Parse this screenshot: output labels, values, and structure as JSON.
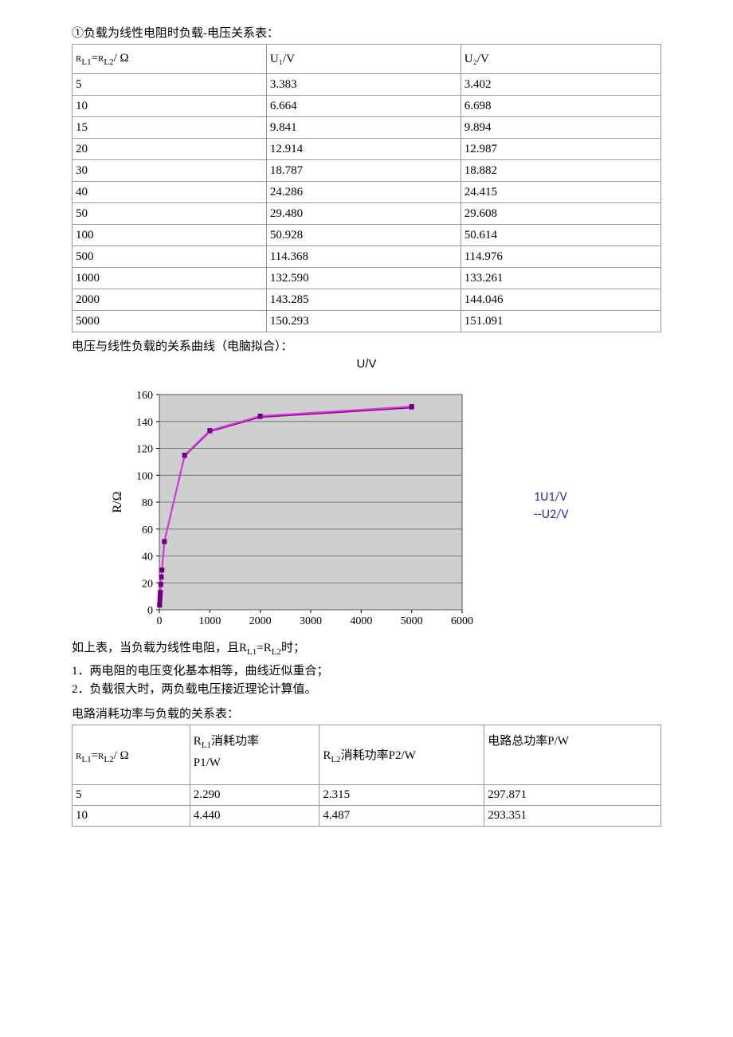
{
  "heading1": "①负载为线性电阻时负载-电压关系表：",
  "table1": {
    "headers": {
      "c0": "RL1=RL2/ Ω",
      "c1": "U₁/V",
      "c2": "U₂/V"
    },
    "rows": [
      {
        "c0": "5",
        "c1": "3.383",
        "c2": "3.402"
      },
      {
        "c0": "10",
        "c1": "6.664",
        "c2": "6.698"
      },
      {
        "c0": "15",
        "c1": "9.841",
        "c2": "9.894"
      },
      {
        "c0": "20",
        "c1": "12.914",
        "c2": "12.987"
      },
      {
        "c0": "30",
        "c1": "18.787",
        "c2": "18.882"
      },
      {
        "c0": "40",
        "c1": "24.286",
        "c2": "24.415"
      },
      {
        "c0": "50",
        "c1": "29.480",
        "c2": "29.608"
      },
      {
        "c0": "100",
        "c1": "50.928",
        "c2": "50.614"
      },
      {
        "c0": "500",
        "c1": "114.368",
        "c2": "114.976"
      },
      {
        "c0": "1000",
        "c1": "132.590",
        "c2": "133.261"
      },
      {
        "c0": "2000",
        "c1": "143.285",
        "c2": "144.046"
      },
      {
        "c0": "5000",
        "c1": "150.293",
        "c2": "151.091"
      }
    ]
  },
  "caption1": "电压与线性负载的关系曲线（电脑拟合）：",
  "chart_title": "U/V",
  "legend": {
    "l1": "1U1/V",
    "l2": "--U2/V"
  },
  "chart_data": {
    "type": "line",
    "title": "U/V",
    "xlabel": "",
    "ylabel": "R/Ω",
    "xlim": [
      0,
      6000
    ],
    "ylim": [
      0,
      160
    ],
    "xticks": [
      0,
      1000,
      2000,
      3000,
      4000,
      5000,
      6000
    ],
    "yticks": [
      0,
      20,
      40,
      60,
      80,
      100,
      120,
      140,
      160
    ],
    "x": [
      5,
      10,
      15,
      20,
      30,
      40,
      50,
      100,
      500,
      1000,
      2000,
      5000
    ],
    "series": [
      {
        "name": "U1/V",
        "color": "#8a009c",
        "values": [
          3.383,
          6.664,
          9.841,
          12.914,
          18.787,
          24.286,
          29.48,
          50.928,
          114.368,
          132.59,
          143.285,
          150.293
        ]
      },
      {
        "name": "U2/V",
        "color": "#d63cd6",
        "values": [
          3.402,
          6.698,
          9.894,
          12.987,
          18.882,
          24.415,
          29.608,
          50.614,
          114.976,
          133.261,
          144.046,
          151.091
        ]
      }
    ]
  },
  "observation_line": "如上表，当负载为线性电阻，且RL1=RL2时；",
  "list": {
    "i1": "1．两电阻的电压变化基本相等，曲线近似重合；",
    "i2": "2．负载很大时，两负载电压接近理论计算值。"
  },
  "heading2": "电路消耗功率与负载的关系表：",
  "table2": {
    "headers": {
      "c0": "RL1=RL2/ Ω",
      "c1a": "RL1消耗功率",
      "c1b": "P1/W",
      "c2": "RL2消耗功率P2/W",
      "c3": "电路总功率P/W"
    },
    "rows": [
      {
        "c0": "5",
        "c1": "2.290",
        "c2": "2.315",
        "c3": "297.871"
      },
      {
        "c0": "10",
        "c1": "4.440",
        "c2": "4.487",
        "c3": "293.351"
      }
    ]
  }
}
